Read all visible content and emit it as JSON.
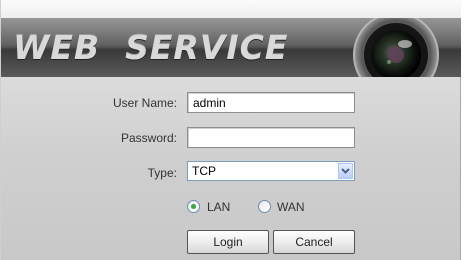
{
  "banner": {
    "title": "WEB  SERVICE",
    "lens_icon": "camera-lens-icon"
  },
  "form": {
    "username_label": "User Name:",
    "username_value": "admin",
    "password_label": "Password:",
    "password_value": "",
    "type_label": "Type:",
    "type_selected": "TCP",
    "network": {
      "options": [
        {
          "label": "LAN",
          "selected": true
        },
        {
          "label": "WAN",
          "selected": false
        }
      ]
    },
    "login_label": "Login",
    "cancel_label": "Cancel"
  },
  "colors": {
    "radio_selected": "#3aa83a",
    "select_border": "#7f9db9",
    "banner_dark": "#3a3a3a"
  }
}
